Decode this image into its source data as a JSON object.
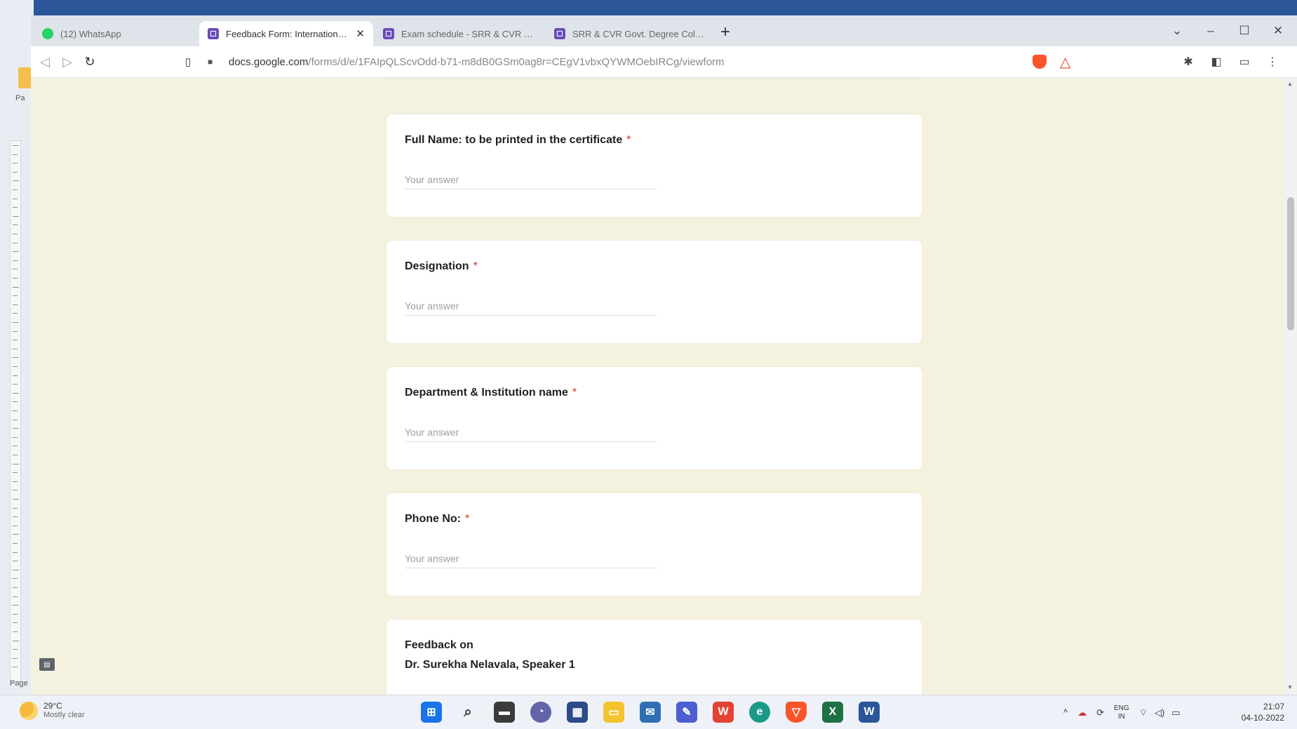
{
  "tabs": [
    {
      "title": "(12) WhatsApp",
      "icon": "whatsapp-icon"
    },
    {
      "title": "Feedback Form: International W...",
      "icon": "google-forms-icon",
      "active": true
    },
    {
      "title": "Exam schedule - SRR & CVR Govt. De...",
      "icon": "google-forms-icon"
    },
    {
      "title": "SRR & CVR Govt. Degree College Vi...",
      "icon": "google-forms-icon"
    }
  ],
  "new_tab_label": "+",
  "window_controls": {
    "minimize": "–",
    "maximize": "☐",
    "close": "✕"
  },
  "address_bar": {
    "host": "docs.google.com",
    "path": "/forms/d/e/1FAIpQLScvOdd-b71-m8dB0GSm0ag8r=CEgV1vbxQYWMOebIRCg/viewform"
  },
  "form": {
    "placeholder": "Your answer",
    "required_mark": "*",
    "questions": [
      {
        "label": "Full Name: to be printed in the certificate",
        "required": true
      },
      {
        "label": "Designation",
        "required": true
      },
      {
        "label": "Department & Institution name",
        "required": true
      },
      {
        "label": "Phone No:",
        "required": true
      }
    ],
    "feedback_section": {
      "line1": "Feedback on",
      "line2": "Dr. Surekha Nelavala, Speaker 1"
    }
  },
  "background_app": {
    "label": "Pa",
    "bottom_label": "Page"
  },
  "taskbar": {
    "weather_temp": "29°C",
    "weather_desc": "Mostly clear",
    "lang_line1": "ENG",
    "lang_line2": "IN",
    "time": "21:07",
    "date": "04-10-2022",
    "apps": [
      "windows-start-icon",
      "search-icon",
      "file-explorer-icon",
      "teams-chat-icon",
      "microsoft-store-icon",
      "folder-icon",
      "mail-icon",
      "whiteboard-icon",
      "wps-office-icon",
      "edge-icon",
      "brave-icon",
      "excel-icon",
      "word-icon"
    ]
  },
  "colors": {
    "page_background": "#f4f1df",
    "required": "#d93025",
    "forms_purple": "#6a4dbb"
  }
}
